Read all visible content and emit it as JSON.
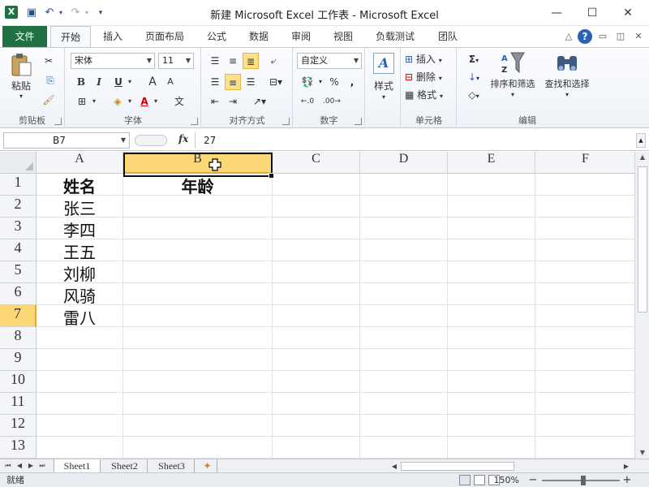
{
  "window": {
    "title": "新建 Microsoft Excel 工作表 - Microsoft Excel",
    "app_icon": "X",
    "qat": {
      "save_icon": "▣",
      "undo_icon": "↶",
      "redo_icon": "↷",
      "customize_icon": "▾"
    },
    "controls": {
      "minimize": "—",
      "maximize": "☐",
      "close": "✕"
    }
  },
  "ribbon_tabs": {
    "file": "文件",
    "items": [
      "开始",
      "插入",
      "页面布局",
      "公式",
      "数据",
      "审阅",
      "视图",
      "负载测试",
      "团队"
    ],
    "right": {
      "collapse": "△",
      "help": "?",
      "restore": "▭",
      "max": "◫",
      "close": "✕"
    }
  },
  "ribbon": {
    "clipboard": {
      "label": "剪贴板",
      "paste": "粘贴",
      "cut_icon": "✂",
      "copy_icon": "⎘",
      "format_painter_icon": "🖌"
    },
    "font": {
      "label": "字体",
      "font_name": "宋体",
      "font_size": "11",
      "bold": "B",
      "italic": "I",
      "underline": "U",
      "grow": "A",
      "shrink": "A",
      "border_icon": "⊞",
      "fill_icon": "◈",
      "font_color": "A",
      "phonetic": "文"
    },
    "alignment": {
      "label": "对齐方式"
    },
    "number": {
      "label": "数字",
      "format": "自定义",
      "currency": "💱",
      "percent": "%",
      "comma": ",",
      "inc_decimal": "←.0",
      "dec_decimal": ".00→"
    },
    "styles": {
      "label": "样式",
      "btn": "样式"
    },
    "cells": {
      "label": "单元格",
      "insert": "插入",
      "delete": "删除",
      "format": "格式"
    },
    "editing": {
      "label": "编辑",
      "sum_icon": "Σ",
      "fill_icon": "↓",
      "clear_icon": "◇",
      "sort_filter": "排序和筛选",
      "find_select": "查找和选择"
    }
  },
  "formula_bar": {
    "name_box": "B7",
    "fx": "fx",
    "value": "27"
  },
  "grid": {
    "columns": [
      "A",
      "B",
      "C",
      "D",
      "E",
      "F"
    ],
    "rows": [
      "1",
      "2",
      "3",
      "4",
      "5",
      "6",
      "7",
      "8",
      "9",
      "10",
      "11",
      "12",
      "13"
    ],
    "cells": {
      "A1": "姓名",
      "B1": "年龄",
      "A2": "张三",
      "A3": "李四",
      "A4": "王五",
      "A5": "刘柳",
      "A6": "风骑",
      "A7": "雷八"
    },
    "selected_cell": "B7"
  },
  "sheets": {
    "tabs": [
      "Sheet1",
      "Sheet2",
      "Sheet3"
    ],
    "active": "Sheet1",
    "new_sheet_icon": "✦"
  },
  "status": {
    "mode": "就绪",
    "zoom": "150%",
    "zoom_out": "−",
    "zoom_in": "+"
  },
  "colors": {
    "accent": "#207245",
    "selection": "#fbd775",
    "highlight_button": "#fde08a"
  }
}
